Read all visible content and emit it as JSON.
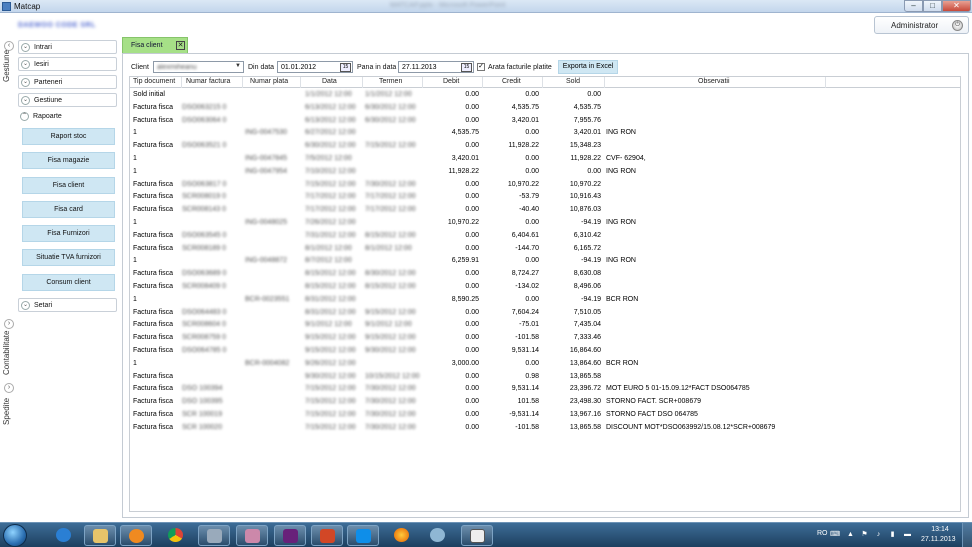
{
  "window": {
    "title": "Matcap",
    "center_title": "MATCAP.pptx - Microsoft PowerPoint",
    "minimize": "–",
    "maximize": "□",
    "close": "✕"
  },
  "header": {
    "company": "DAEWOO CODE SRL",
    "user_button": "Administrator"
  },
  "rail": {
    "labels": [
      "Gestiune",
      "Contabilitate",
      "Spedite"
    ]
  },
  "nav": {
    "items": [
      "Intrari",
      "Iesiri",
      "Parteneri",
      "Gestiune",
      "Rapoarte",
      "Setari"
    ],
    "rapoarte_sub": [
      "Raport stoc",
      "Fisa magazie",
      "Fisa client",
      "Fisa card",
      "Fisa Furnizori",
      "Situatie TVA furnizori",
      "Consum client"
    ]
  },
  "tab": {
    "label": "Fisa client",
    "close": "✕"
  },
  "filters": {
    "client_label": "Client",
    "client_value": "alexmiheanu",
    "from_label": "Din data",
    "from_value": "01.01.2012",
    "to_label": "Pana in data",
    "to_value": "27.11.2013",
    "paid_label": "Arata facturile platite",
    "paid_checked": "✓",
    "export_label": "Exporta in Excel",
    "calendar_icon": "15"
  },
  "grid": {
    "columns": [
      "Tip document",
      "Numar factura",
      "Numar plata",
      "Data",
      "Termen",
      "Debit",
      "Credit",
      "Sold",
      "Observatii"
    ],
    "rows": [
      {
        "tip": "Sold initial",
        "nf": "",
        "np": "",
        "data": "1/1/2012 12:00",
        "termen": "1/1/2012 12:00",
        "debit": "0.00",
        "credit": "0.00",
        "sold": "0.00",
        "obs": ""
      },
      {
        "tip": "Factura fisca",
        "nf": "DSO063215 0",
        "np": "",
        "data": "6/13/2012 12:00",
        "termen": "6/30/2012 12:00",
        "debit": "0.00",
        "credit": "4,535.75",
        "sold": "4,535.75",
        "obs": ""
      },
      {
        "tip": "Factura fisca",
        "nf": "DSO063064 0",
        "np": "",
        "data": "6/13/2012 12:00",
        "termen": "6/30/2012 12:00",
        "debit": "0.00",
        "credit": "3,420.01",
        "sold": "7,955.76",
        "obs": ""
      },
      {
        "tip": "1",
        "nf": "",
        "np": "ING-0047530",
        "data": "6/27/2012 12:00",
        "termen": "",
        "debit": "4,535.75",
        "credit": "0.00",
        "sold": "3,420.01",
        "obs": "ING RON"
      },
      {
        "tip": "Factura fisca",
        "nf": "DSO063521 0",
        "np": "",
        "data": "6/30/2012 12:00",
        "termen": "7/15/2012 12:00",
        "debit": "0.00",
        "credit": "11,928.22",
        "sold": "15,348.23",
        "obs": ""
      },
      {
        "tip": "1",
        "nf": "",
        "np": "ING-0047845",
        "data": "7/5/2012 12:00",
        "termen": "",
        "debit": "3,420.01",
        "credit": "0.00",
        "sold": "11,928.22",
        "obs": "CVF- 62904,"
      },
      {
        "tip": "1",
        "nf": "",
        "np": "ING-0047954",
        "data": "7/10/2012 12:00",
        "termen": "",
        "debit": "11,928.22",
        "credit": "0.00",
        "sold": "0.00",
        "obs": "ING RON"
      },
      {
        "tip": "Factura fisca",
        "nf": "DSO063817 0",
        "np": "",
        "data": "7/15/2012 12:00",
        "termen": "7/30/2012 12:00",
        "debit": "0.00",
        "credit": "10,970.22",
        "sold": "10,970.22",
        "obs": ""
      },
      {
        "tip": "Factura fisca",
        "nf": "SCR008019 0",
        "np": "",
        "data": "7/17/2012 12:00",
        "termen": "7/17/2012 12:00",
        "debit": "0.00",
        "credit": "-53.79",
        "sold": "10,916.43",
        "obs": ""
      },
      {
        "tip": "Factura fisca",
        "nf": "SCR008143 0",
        "np": "",
        "data": "7/17/2012 12:00",
        "termen": "7/17/2012 12:00",
        "debit": "0.00",
        "credit": "-40.40",
        "sold": "10,876.03",
        "obs": ""
      },
      {
        "tip": "1",
        "nf": "",
        "np": "ING-0048025",
        "data": "7/26/2012 12:00",
        "termen": "",
        "debit": "10,970.22",
        "credit": "0.00",
        "sold": "-94.19",
        "obs": "ING RON"
      },
      {
        "tip": "Factura fisca",
        "nf": "DSO063545 0",
        "np": "",
        "data": "7/31/2012 12:00",
        "termen": "8/15/2012 12:00",
        "debit": "0.00",
        "credit": "6,404.61",
        "sold": "6,310.42",
        "obs": ""
      },
      {
        "tip": "Factura fisca",
        "nf": "SCR008189 0",
        "np": "",
        "data": "8/1/2012 12:00",
        "termen": "8/1/2012 12:00",
        "debit": "0.00",
        "credit": "-144.70",
        "sold": "6,165.72",
        "obs": ""
      },
      {
        "tip": "1",
        "nf": "",
        "np": "ING-0048872",
        "data": "8/7/2012 12:00",
        "termen": "",
        "debit": "6,259.91",
        "credit": "0.00",
        "sold": "-94.19",
        "obs": "ING RON"
      },
      {
        "tip": "Factura fisca",
        "nf": "DSO063689 0",
        "np": "",
        "data": "8/15/2012 12:00",
        "termen": "8/30/2012 12:00",
        "debit": "0.00",
        "credit": "8,724.27",
        "sold": "8,630.08",
        "obs": ""
      },
      {
        "tip": "Factura fisca",
        "nf": "SCR008409 0",
        "np": "",
        "data": "8/15/2012 12:00",
        "termen": "8/15/2012 12:00",
        "debit": "0.00",
        "credit": "-134.02",
        "sold": "8,496.06",
        "obs": ""
      },
      {
        "tip": "1",
        "nf": "",
        "np": "BCR-0023551",
        "data": "8/31/2012 12:00",
        "termen": "",
        "debit": "8,590.25",
        "credit": "0.00",
        "sold": "-94.19",
        "obs": "BCR RON"
      },
      {
        "tip": "Factura fisca",
        "nf": "DSO064483 0",
        "np": "",
        "data": "8/31/2012 12:00",
        "termen": "9/15/2012 12:00",
        "debit": "0.00",
        "credit": "7,604.24",
        "sold": "7,510.05",
        "obs": ""
      },
      {
        "tip": "Factura fisca",
        "nf": "SCR008604 0",
        "np": "",
        "data": "9/1/2012 12:00",
        "termen": "9/1/2012 12:00",
        "debit": "0.00",
        "credit": "-75.01",
        "sold": "7,435.04",
        "obs": ""
      },
      {
        "tip": "Factura fisca",
        "nf": "SCR008759 0",
        "np": "",
        "data": "9/15/2012 12:00",
        "termen": "9/15/2012 12:00",
        "debit": "0.00",
        "credit": "-101.58",
        "sold": "7,333.46",
        "obs": ""
      },
      {
        "tip": "Factura fisca",
        "nf": "DSO064785 0",
        "np": "",
        "data": "9/15/2012 12:00",
        "termen": "9/30/2012 12:00",
        "debit": "0.00",
        "credit": "9,531.14",
        "sold": "16,864.60",
        "obs": ""
      },
      {
        "tip": "1",
        "nf": "",
        "np": "BCR-0004082",
        "data": "9/26/2012 12:00",
        "termen": "",
        "debit": "3,000.00",
        "credit": "0.00",
        "sold": "13,864.60",
        "obs": "BCR RON"
      },
      {
        "tip": "Factura fisca",
        "nf": "",
        "np": "",
        "data": "9/30/2012 12:00",
        "termen": "10/15/2012 12:00",
        "debit": "0.00",
        "credit": "0.98",
        "sold": "13,865.58",
        "obs": ""
      },
      {
        "tip": "Factura fisca",
        "nf": "DSO 100394",
        "np": "",
        "data": "7/15/2012 12:00",
        "termen": "7/30/2012 12:00",
        "debit": "0.00",
        "credit": "9,531.14",
        "sold": "23,396.72",
        "obs": "MOT EURO 5 01-15.09.12*FACT DSO064785"
      },
      {
        "tip": "Factura fisca",
        "nf": "DSO 100395",
        "np": "",
        "data": "7/15/2012 12:00",
        "termen": "7/30/2012 12:00",
        "debit": "0.00",
        "credit": "101.58",
        "sold": "23,498.30",
        "obs": "STORNO FACT. SCR+008679"
      },
      {
        "tip": "Factura fisca",
        "nf": "SCR 100019",
        "np": "",
        "data": "7/15/2012 12:00",
        "termen": "7/30/2012 12:00",
        "debit": "0.00",
        "credit": "-9,531.14",
        "sold": "13,967.16",
        "obs": "STORNO FACT DSO 064785"
      },
      {
        "tip": "Factura fisca",
        "nf": "SCR 100020",
        "np": "",
        "data": "7/15/2012 12:00",
        "termen": "7/30/2012 12:00",
        "debit": "0.00",
        "credit": "-101.58",
        "sold": "13,865.58",
        "obs": "DISCOUNT MOT*DSO063992/15.08.12*SCR+008679"
      }
    ]
  },
  "taskbar": {
    "lang": "RO",
    "time": "13:14",
    "date": "27.11.2013"
  },
  "colors": {
    "tab_active": "#a6e087",
    "sub_button": "#cfe7f3",
    "close_btn": "#c7493a"
  }
}
